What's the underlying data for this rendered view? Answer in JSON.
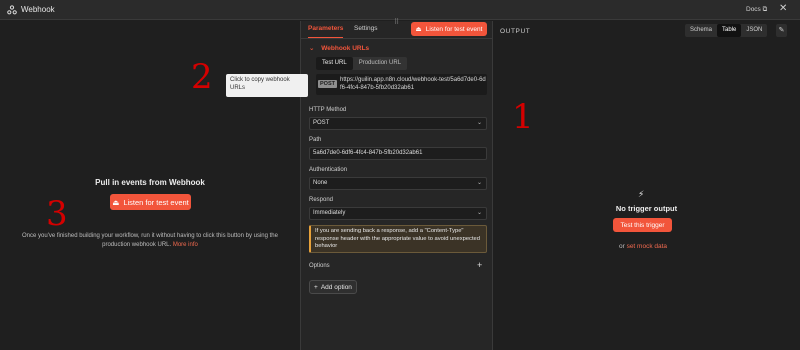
{
  "titlebar": {
    "title": "Webhook",
    "docs": "Docs ⧉",
    "close": "✕"
  },
  "left": {
    "marker": "3",
    "heading": "Pull in events from Webhook",
    "listen_button": "Listen for test event",
    "help_text": "Once you've finished building your workflow, run it without having to click this button by using the production webhook URL.",
    "more_info": "More info"
  },
  "params": {
    "tabs": [
      "Parameters",
      "Settings"
    ],
    "listen_button": "Listen for test event",
    "webhook_urls_heading": "Webhook URLs",
    "url_tabs": [
      "Test URL",
      "Production URL"
    ],
    "url": {
      "method": "POST",
      "value": "https://guilin.app.n8n.cloud/webhook-test/5a6d7de0-6df6-4fc4-847b-5fb20d32ab61"
    },
    "http_method": {
      "label": "HTTP Method",
      "value": "POST"
    },
    "path": {
      "label": "Path",
      "value": "5a6d7de0-6df6-4fc4-847b-5fb20d32ab61"
    },
    "authentication": {
      "label": "Authentication",
      "value": "None"
    },
    "respond": {
      "label": "Respond",
      "value": "Immediately"
    },
    "notice": "If you are sending back a response, add a \"Content-Type\" response header with the appropriate value to avoid unexpected behavior",
    "options_label": "Options",
    "add_option": "Add option"
  },
  "tooltip": {
    "text": "Click to copy webhook URLs",
    "marker": "2"
  },
  "output": {
    "label": "OUTPUT",
    "views": [
      "Schema",
      "Table",
      "JSON"
    ],
    "active_view": "Table",
    "marker": "1",
    "no_trigger": "No trigger output",
    "test_button": "Test this trigger",
    "or_text": "or",
    "mock_link": "set mock data"
  },
  "colors": {
    "accent": "#f2553b",
    "marker": "#d40000"
  }
}
